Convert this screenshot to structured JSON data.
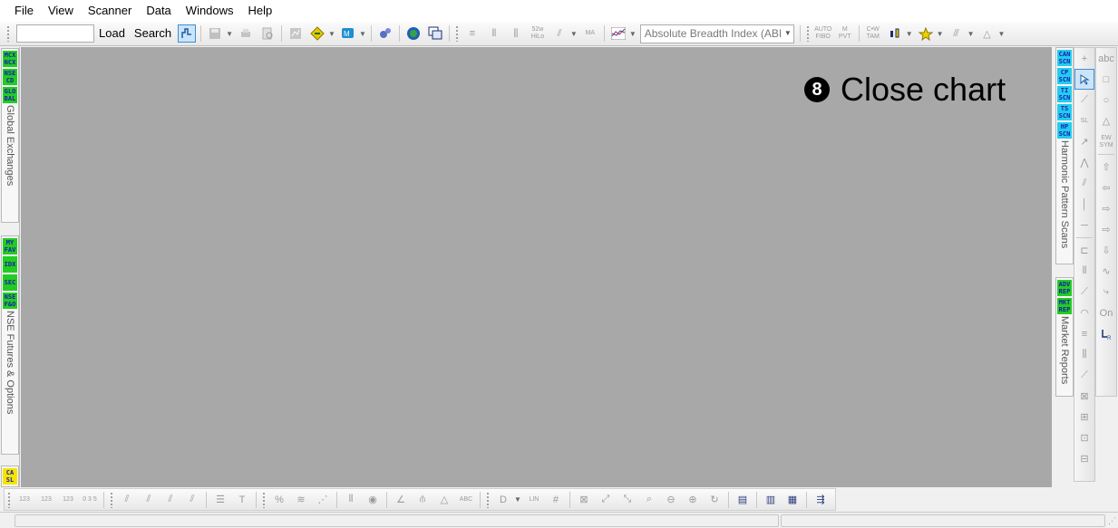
{
  "menu": [
    "File",
    "View",
    "Scanner",
    "Data",
    "Windows",
    "Help"
  ],
  "toolbar": {
    "symbol_input_value": "",
    "load_label": "Load",
    "search_label": "Search",
    "indicator_select_value": "Absolute Breadth Index (ABI",
    "labels": {
      "e52w": "52w\nHiLo",
      "ma": "MA",
      "autofibo": "AUTO\nFIBO",
      "mpvt": "M\nPVT",
      "cam": "C•W\nTAM",
      "tnr": "TNR"
    }
  },
  "left_panel": {
    "group1": {
      "buttons": [
        "MCX\nNCX",
        "NSE\nCD",
        "GLO\nBAL"
      ],
      "caption": "Global Exchanges"
    },
    "group2": {
      "buttons": [
        "MY\nFAV",
        "IDX",
        "SEC",
        "NSE\nF&O"
      ],
      "caption": "NSE Futures & Options"
    },
    "group3": {
      "buttons": [
        "CA\nSL"
      ]
    }
  },
  "chart": {
    "close_chart_number": "8",
    "close_chart_label": "Close chart"
  },
  "right_panel": {
    "group1": {
      "buttons": [
        "CAN\nSCN",
        "CP\nSCN",
        "TI\nSCN",
        "TS\nSCN",
        "HP\nSCN"
      ],
      "caption": "Harmonic Pattern Scans"
    },
    "group2": {
      "buttons": [
        "ADV\nREP",
        "MKT\nREP"
      ],
      "caption": "Market Reports"
    }
  },
  "drawing_tools": {
    "abc": "abc",
    "sl": "SL",
    "ewsym": "EW\nSYM",
    "on": "On"
  },
  "bottom_toolbar": {
    "labels": {
      "n123": "123",
      "n123b": "123",
      "n123c": "123",
      "n0": "0 3 5",
      "d": "D",
      "lin": "LIN",
      "abc": "ABC"
    }
  },
  "colors": {
    "chart_background": "#a8a8a8",
    "exchange_button": "#22cc22",
    "scanner_button": "#22ccee",
    "ca_sl_button": "#f5e400",
    "button_text": "#1b1bb0"
  }
}
